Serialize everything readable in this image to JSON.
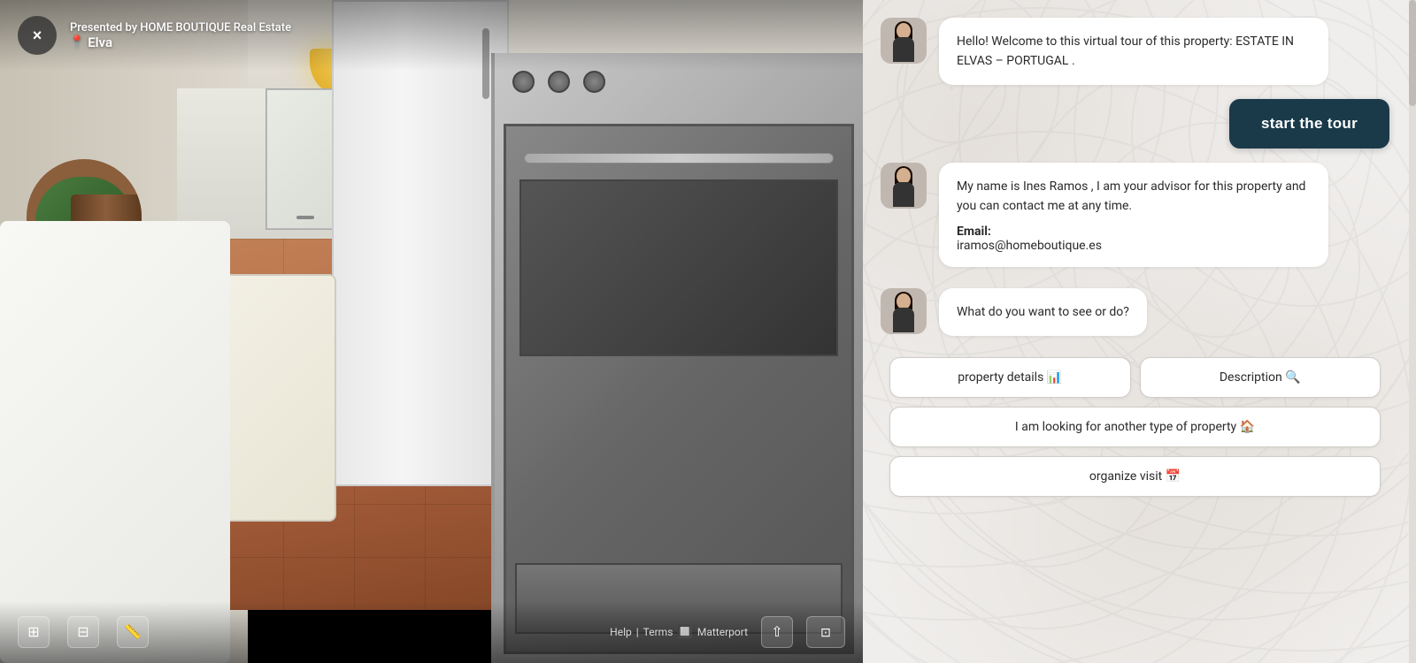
{
  "tour": {
    "presenter": "Presented by HOME BOUTIQUE Real Estate",
    "location": "Elva",
    "close_label": "×"
  },
  "toolbar": {
    "help": "Help",
    "separator": "|",
    "terms": "Terms",
    "matterport": "Matterport"
  },
  "chat": {
    "messages": [
      {
        "id": "welcome",
        "text": "Hello! Welcome to this virtual tour of this property:  ESTATE IN ELVAS – PORTUGAL ."
      },
      {
        "id": "advisor",
        "name_line": "My name   is Ines Ramos , I am your advisor for this property and you can contact me at any time.",
        "email_label": "Email:",
        "email_value": "iramos@homeboutique.es"
      },
      {
        "id": "question",
        "text": "What do you want to see or do?"
      }
    ],
    "start_tour_label": "start the tour",
    "actions": {
      "property_details": "property details 📊",
      "description": "Description 🔍",
      "looking_for_another": "I am looking for another type of property 🏠",
      "organize_visit": "organize  visit 📅"
    }
  }
}
